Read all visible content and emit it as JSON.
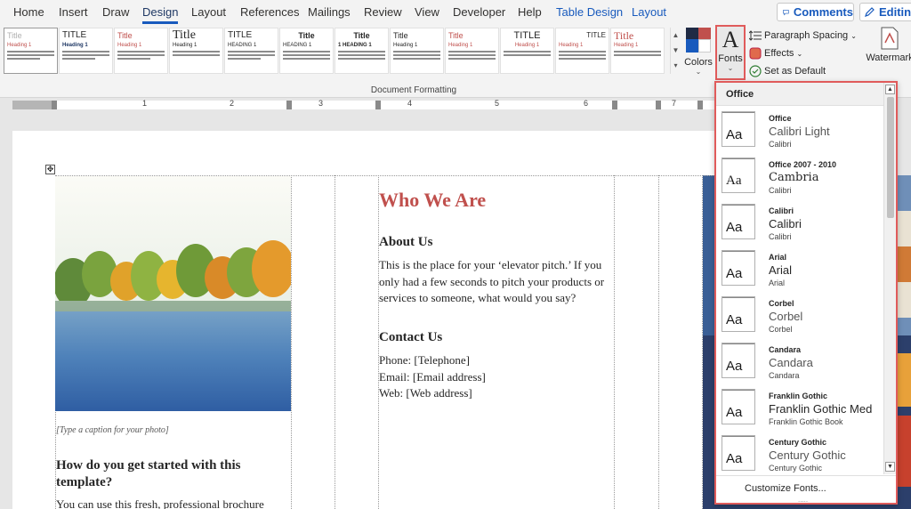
{
  "menu": {
    "tabs": [
      {
        "label": "Home"
      },
      {
        "label": "Insert"
      },
      {
        "label": "Draw"
      },
      {
        "label": "Design"
      },
      {
        "label": "Layout"
      },
      {
        "label": "References"
      },
      {
        "label": "Mailings"
      },
      {
        "label": "Review"
      },
      {
        "label": "View"
      },
      {
        "label": "Developer"
      },
      {
        "label": "Help"
      },
      {
        "label": "Table Design"
      },
      {
        "label": "Layout"
      }
    ],
    "active_tab": "Design",
    "comments_label": "Comments",
    "editing_label": "Editing"
  },
  "ribbon": {
    "style_sets": [
      {
        "title": "Title",
        "heading": "Heading 1"
      },
      {
        "title": "TITLE",
        "heading": "Heading 1"
      },
      {
        "title": "Title",
        "heading": "Heading 1"
      },
      {
        "title": "Title",
        "heading": "Heading 1"
      },
      {
        "title": "TITLE",
        "heading": "HEADING 1"
      },
      {
        "title": "Title",
        "heading": "HEADING 1"
      },
      {
        "title": "Title",
        "heading": "1 HEADING 1"
      },
      {
        "title": "Title",
        "heading": "Heading 1"
      },
      {
        "title": "Title",
        "heading": "Heading 1"
      },
      {
        "title": "TITLE",
        "heading": "Heading 1"
      },
      {
        "title": "TITLE",
        "heading": "Heading 1"
      },
      {
        "title": "Title",
        "heading": "Heading 1"
      }
    ],
    "document_formatting_label": "Document Formatting",
    "colors_label": "Colors",
    "fonts_label": "Fonts",
    "paragraph_spacing_label": "Paragraph Spacing",
    "effects_label": "Effects",
    "set_as_default_label": "Set as Default",
    "watermark_label": "Watermark"
  },
  "ruler": {
    "numbers": [
      "1",
      "2",
      "3",
      "4",
      "5",
      "6",
      "7"
    ]
  },
  "document": {
    "caption": "[Type a caption for your photo]",
    "left_heading": "How do you get started with this template?",
    "left_body": "You can use this fresh, professional brochure",
    "who_we_are": "Who We Are",
    "about_us_heading": "About Us",
    "about_us_body": "This is the place for your ‘elevator pitch.’ If you only had a few seconds to pitch your products or services to someone, what would you say?",
    "contact_heading": "Contact Us",
    "phone": "Phone: [Telephone]",
    "email": "Email: [Email address]",
    "web": "Web: [Web address]"
  },
  "fonts_panel": {
    "header": "Office",
    "items": [
      {
        "name": "Office",
        "heading": "Calibri Light",
        "body": "Calibri"
      },
      {
        "name": "Office 2007 - 2010",
        "heading": "Cambria",
        "body": "Calibri"
      },
      {
        "name": "Calibri",
        "heading": "Calibri",
        "body": "Calibri"
      },
      {
        "name": "Arial",
        "heading": "Arial",
        "body": "Arial"
      },
      {
        "name": "Corbel",
        "heading": "Corbel",
        "body": "Corbel"
      },
      {
        "name": "Candara",
        "heading": "Candara",
        "body": "Candara"
      },
      {
        "name": "Franklin Gothic",
        "heading": "Franklin Gothic Med",
        "body": "Franklin Gothic Book"
      },
      {
        "name": "Century Gothic",
        "heading": "Century Gothic",
        "body": "Century Gothic"
      }
    ],
    "thumb_glyph": "Aa",
    "customize_label": "Customize Fonts...",
    "grip": "....."
  },
  "colors": {
    "accent": "#185abd",
    "heading_red": "#c0504d",
    "highlight_border": "#e05b5b"
  },
  "icons": {
    "comments": "comment-icon",
    "editing": "pencil-icon",
    "fonts": "fonts-A-icon",
    "paragraph_spacing": "paragraph-spacing-icon",
    "effects": "effects-icon",
    "set_as_default": "checkmark-icon",
    "watermark": "watermark-icon",
    "table_move": "move-handle-icon"
  }
}
